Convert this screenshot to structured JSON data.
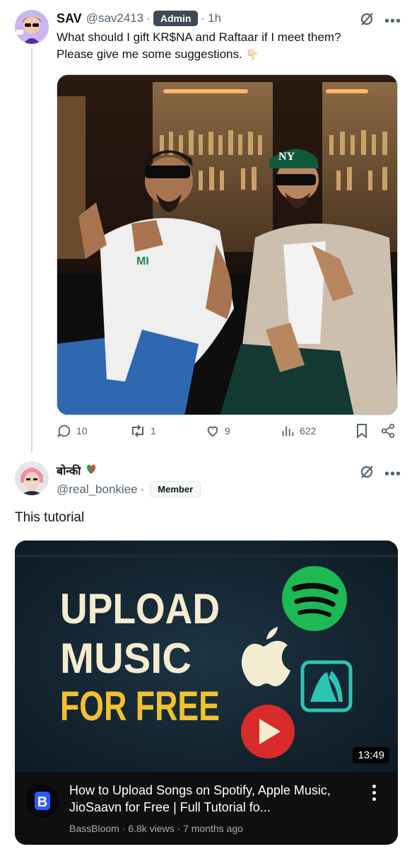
{
  "post1": {
    "display_name": "SAV",
    "handle": "@sav2413",
    "separator": "·",
    "badge": "Admin",
    "time": "1h",
    "text_line1": "What should I gift KR$NA and Raftaar if I meet them?",
    "text_line2": "Please give me some suggestions.",
    "emoji": "👇🏻",
    "stats": {
      "replies": "10",
      "reposts": "1",
      "likes": "9",
      "views": "622"
    }
  },
  "post2": {
    "display_name": "बोन्की",
    "handle": "@real_bonkiee",
    "separator": "·",
    "badge": "Member",
    "text": "This tutorial"
  },
  "video": {
    "thumb_line1": "UPLOAD",
    "thumb_line2": "MUSIC",
    "thumb_line3": "FOR FREE",
    "duration": "13:49",
    "title": "How to Upload Songs on Spotify, Apple Music, JioSaavn for Free | Full Tutorial fo...",
    "channel": "BassBloom",
    "views": "6.8k views",
    "age": "7 months ago",
    "meta_sep": "·",
    "channel_initial": "B"
  },
  "colors": {
    "thumb_bg": "#142430",
    "headline_cream": "#f4ecd0",
    "headline_yellow": "#f2c12e",
    "spotify": "#1db954",
    "youtube_red": "#d92b2b",
    "jiosaavn": "#2bc5b4"
  },
  "icons": [
    "grok-icon",
    "more-icon",
    "reply-icon",
    "repost-icon",
    "like-icon",
    "views-icon",
    "bookmark-icon",
    "share-icon",
    "spotify-logo",
    "apple-logo",
    "jiosaavn-logo",
    "play-logo"
  ]
}
